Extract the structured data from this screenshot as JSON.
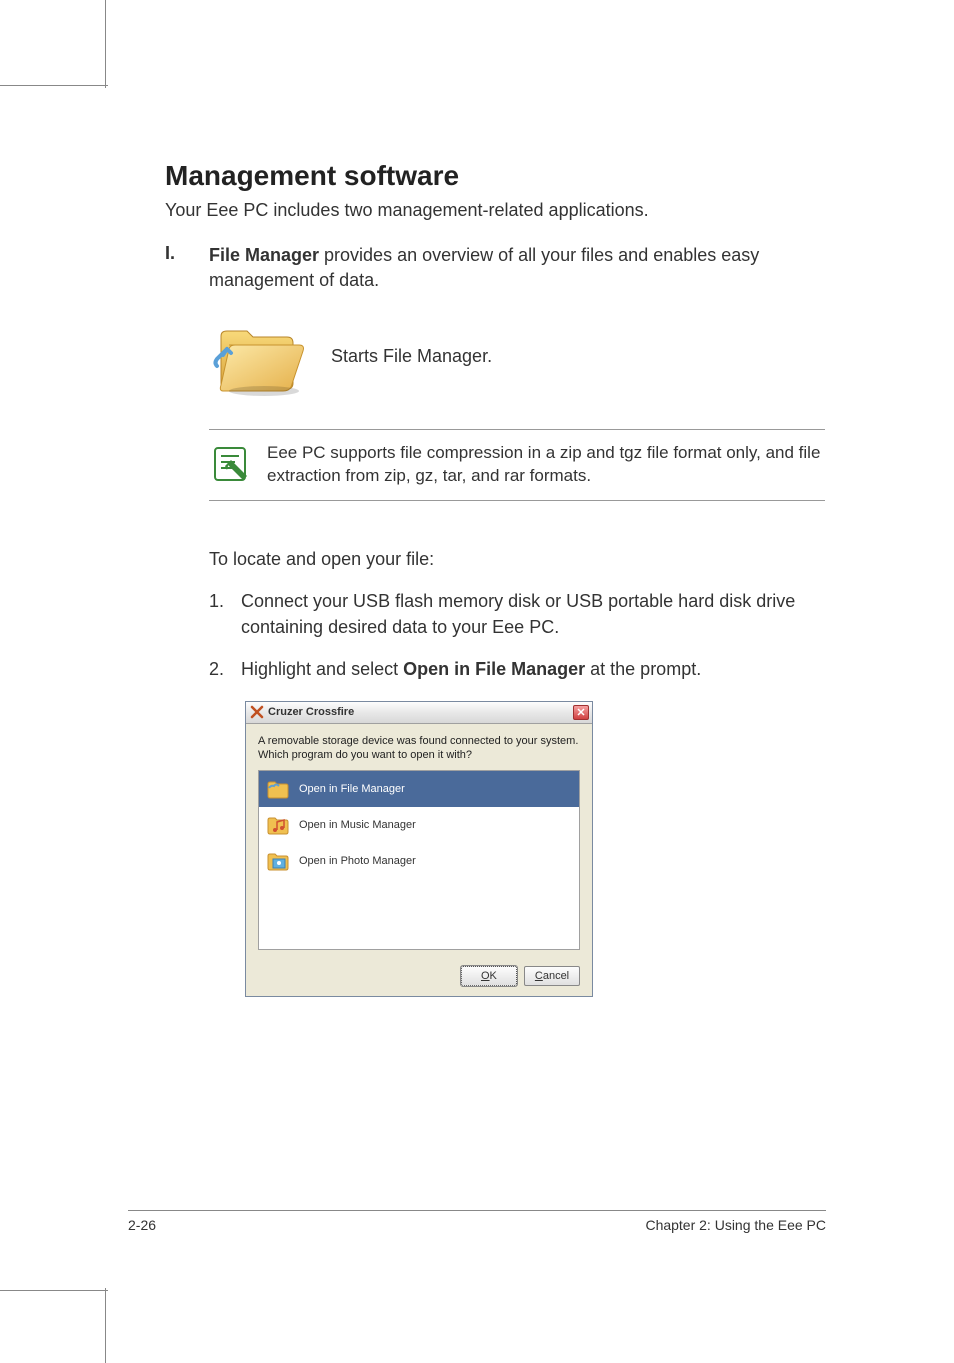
{
  "heading": "Management software",
  "intro": "Your Eee PC includes two management-related applications.",
  "section": {
    "marker": "I.",
    "title": "File Manager",
    "desc": " provides an overview of all your files and enables easy management of data."
  },
  "icon_caption": "Starts File Manager.",
  "note": "Eee PC supports file compression in a zip and tgz file format only, and file extraction from zip, gz, tar, and rar formats.",
  "subheading": "To locate and open your file:",
  "steps": [
    {
      "num": "1.",
      "text": "Connect your USB flash memory disk or USB portable hard disk drive containing desired data to your Eee PC."
    },
    {
      "num": "2.",
      "prefix": "Highlight and select ",
      "bold": "Open in File Manager",
      "suffix": " at the prompt."
    }
  ],
  "dialog": {
    "title": "Cruzer Crossfire",
    "message": "A removable storage device was found connected to your system. Which program do you want to open it with?",
    "options": [
      {
        "label": "Open in File Manager",
        "selected": true
      },
      {
        "label": "Open in Music Manager",
        "selected": false
      },
      {
        "label": "Open in Photo Manager",
        "selected": false
      }
    ],
    "ok_label": "OK",
    "cancel_label": "Cancel"
  },
  "footer": {
    "page": "2-26",
    "chapter": "Chapter 2: Using the Eee PC"
  }
}
